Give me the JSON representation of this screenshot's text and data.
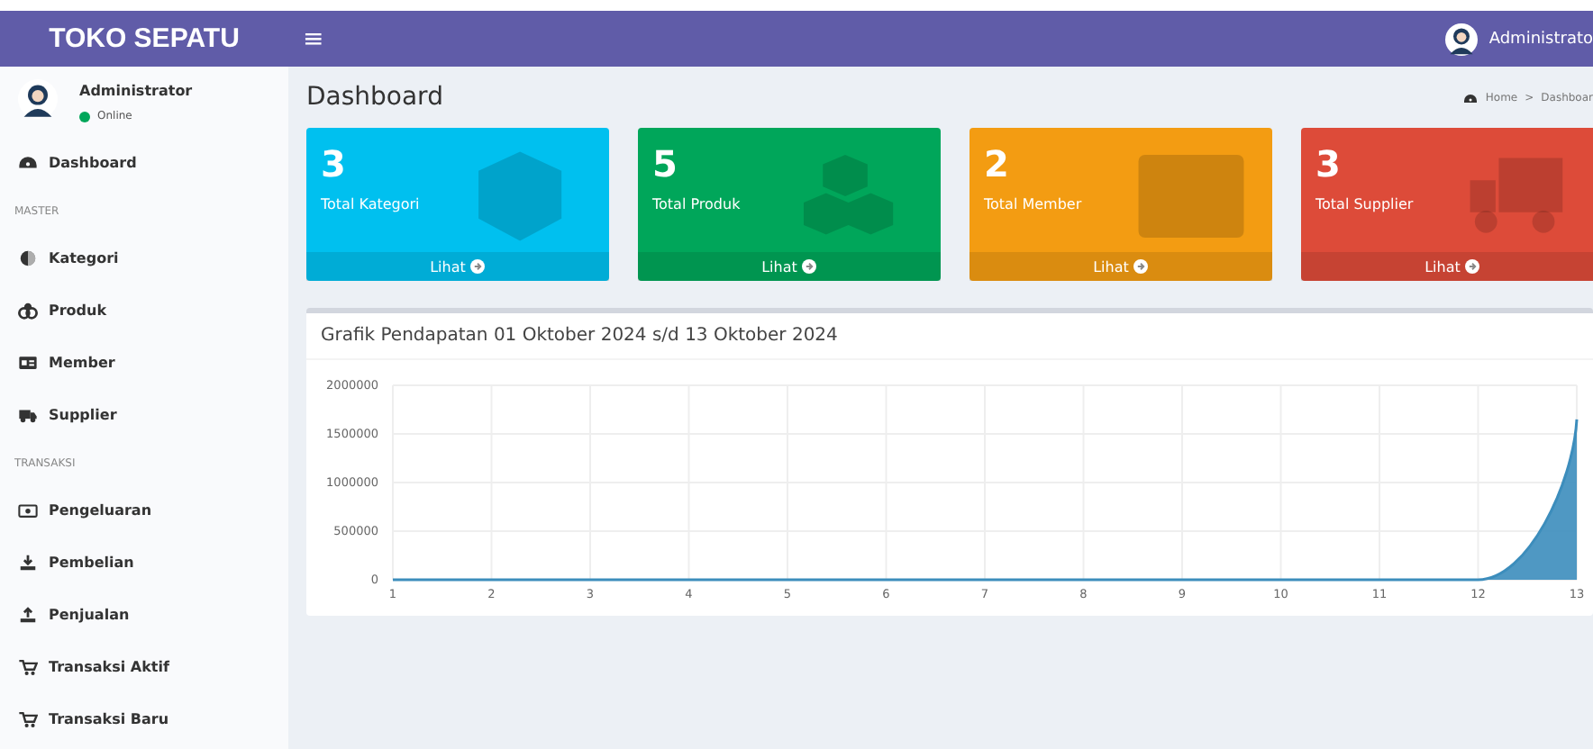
{
  "navbar": {
    "brand": "TOKO SEPATU",
    "menu_toggle": "≡",
    "user": "Administrato"
  },
  "sidebar": {
    "user": {
      "name": "Administrator",
      "status": "Online"
    },
    "items": [
      {
        "kind": "link",
        "label": "Dashboard"
      },
      {
        "kind": "header",
        "label": "MASTER"
      },
      {
        "kind": "link",
        "label": "Kategori"
      },
      {
        "kind": "link",
        "label": "Produk"
      },
      {
        "kind": "link",
        "label": "Member"
      },
      {
        "kind": "link",
        "label": "Supplier"
      },
      {
        "kind": "header",
        "label": "TRANSAKSI"
      },
      {
        "kind": "link",
        "label": "Pengeluaran"
      },
      {
        "kind": "link",
        "label": "Pembelian"
      },
      {
        "kind": "link",
        "label": "Penjualan"
      },
      {
        "kind": "link",
        "label": "Transaksi Aktif"
      },
      {
        "kind": "link",
        "label": "Transaksi Baru"
      }
    ]
  },
  "page": {
    "title": "Dashboard",
    "breadcrumb": [
      "Home",
      "Dashboar"
    ],
    "breadcrumb_separator": ">"
  },
  "cards": [
    {
      "value": "3",
      "label": "Total Kategori",
      "link": "Lihat",
      "color": "#00c0ef"
    },
    {
      "value": "5",
      "label": "Total Produk",
      "link": "Lihat",
      "color": "#00a65a"
    },
    {
      "value": "2",
      "label": "Total Member",
      "link": "Lihat",
      "color": "#f39c12"
    },
    {
      "value": "3",
      "label": "Total Supplier",
      "link": "Lihat",
      "color": "#dd4b39"
    }
  ],
  "chart": {
    "title": "Grafik Pendapatan 01 Oktober 2024 s/d 13 Oktober 2024",
    "chart_data": {
      "type": "area",
      "x": [
        1,
        2,
        3,
        4,
        5,
        6,
        7,
        8,
        9,
        10,
        11,
        12,
        13
      ],
      "series": [
        {
          "color": "#3c8dbc",
          "values": [
            0,
            0,
            0,
            0,
            0,
            0,
            0,
            0,
            0,
            0,
            0,
            0,
            1650000
          ]
        }
      ],
      "xlim": [
        1,
        13
      ],
      "ylim": [
        0,
        2000000
      ],
      "grid": true,
      "xticks": [
        {
          "value": 1,
          "label": "1"
        },
        {
          "value": 2,
          "label": "2"
        },
        {
          "value": 3,
          "label": "3"
        },
        {
          "value": 4,
          "label": "4"
        },
        {
          "value": 5,
          "label": "5"
        },
        {
          "value": 6,
          "label": "6"
        },
        {
          "value": 7,
          "label": "7"
        },
        {
          "value": 8,
          "label": "8"
        },
        {
          "value": 9,
          "label": "9"
        },
        {
          "value": 10,
          "label": "10"
        },
        {
          "value": 11,
          "label": "11"
        },
        {
          "value": 12,
          "label": "12"
        },
        {
          "value": 13,
          "label": "13"
        }
      ],
      "yticks": [
        {
          "value": 0,
          "label": "0"
        },
        {
          "value": 500000,
          "label": "500000"
        },
        {
          "value": 1000000,
          "label": "1000000"
        },
        {
          "value": 1500000,
          "label": "1500000"
        },
        {
          "value": 2000000,
          "label": "2000000"
        }
      ]
    }
  }
}
